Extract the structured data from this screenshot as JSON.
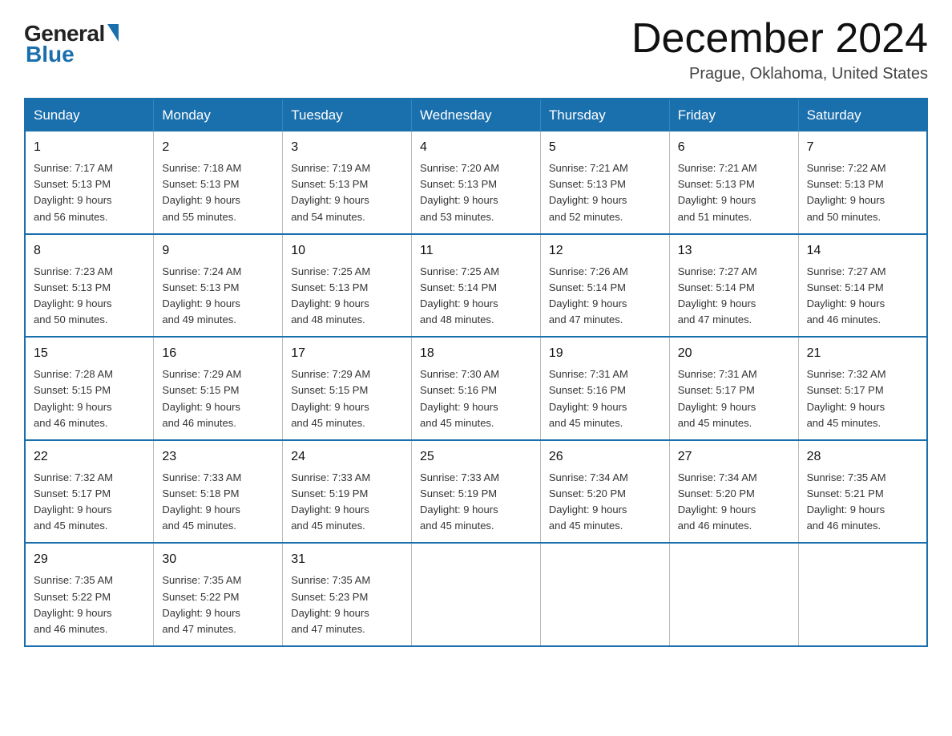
{
  "logo": {
    "general": "General",
    "blue": "Blue"
  },
  "title": "December 2024",
  "subtitle": "Prague, Oklahoma, United States",
  "days_of_week": [
    "Sunday",
    "Monday",
    "Tuesday",
    "Wednesday",
    "Thursday",
    "Friday",
    "Saturday"
  ],
  "weeks": [
    [
      {
        "day": "1",
        "sunrise": "7:17 AM",
        "sunset": "5:13 PM",
        "daylight": "9 hours and 56 minutes."
      },
      {
        "day": "2",
        "sunrise": "7:18 AM",
        "sunset": "5:13 PM",
        "daylight": "9 hours and 55 minutes."
      },
      {
        "day": "3",
        "sunrise": "7:19 AM",
        "sunset": "5:13 PM",
        "daylight": "9 hours and 54 minutes."
      },
      {
        "day": "4",
        "sunrise": "7:20 AM",
        "sunset": "5:13 PM",
        "daylight": "9 hours and 53 minutes."
      },
      {
        "day": "5",
        "sunrise": "7:21 AM",
        "sunset": "5:13 PM",
        "daylight": "9 hours and 52 minutes."
      },
      {
        "day": "6",
        "sunrise": "7:21 AM",
        "sunset": "5:13 PM",
        "daylight": "9 hours and 51 minutes."
      },
      {
        "day": "7",
        "sunrise": "7:22 AM",
        "sunset": "5:13 PM",
        "daylight": "9 hours and 50 minutes."
      }
    ],
    [
      {
        "day": "8",
        "sunrise": "7:23 AM",
        "sunset": "5:13 PM",
        "daylight": "9 hours and 50 minutes."
      },
      {
        "day": "9",
        "sunrise": "7:24 AM",
        "sunset": "5:13 PM",
        "daylight": "9 hours and 49 minutes."
      },
      {
        "day": "10",
        "sunrise": "7:25 AM",
        "sunset": "5:13 PM",
        "daylight": "9 hours and 48 minutes."
      },
      {
        "day": "11",
        "sunrise": "7:25 AM",
        "sunset": "5:14 PM",
        "daylight": "9 hours and 48 minutes."
      },
      {
        "day": "12",
        "sunrise": "7:26 AM",
        "sunset": "5:14 PM",
        "daylight": "9 hours and 47 minutes."
      },
      {
        "day": "13",
        "sunrise": "7:27 AM",
        "sunset": "5:14 PM",
        "daylight": "9 hours and 47 minutes."
      },
      {
        "day": "14",
        "sunrise": "7:27 AM",
        "sunset": "5:14 PM",
        "daylight": "9 hours and 46 minutes."
      }
    ],
    [
      {
        "day": "15",
        "sunrise": "7:28 AM",
        "sunset": "5:15 PM",
        "daylight": "9 hours and 46 minutes."
      },
      {
        "day": "16",
        "sunrise": "7:29 AM",
        "sunset": "5:15 PM",
        "daylight": "9 hours and 46 minutes."
      },
      {
        "day": "17",
        "sunrise": "7:29 AM",
        "sunset": "5:15 PM",
        "daylight": "9 hours and 45 minutes."
      },
      {
        "day": "18",
        "sunrise": "7:30 AM",
        "sunset": "5:16 PM",
        "daylight": "9 hours and 45 minutes."
      },
      {
        "day": "19",
        "sunrise": "7:31 AM",
        "sunset": "5:16 PM",
        "daylight": "9 hours and 45 minutes."
      },
      {
        "day": "20",
        "sunrise": "7:31 AM",
        "sunset": "5:17 PM",
        "daylight": "9 hours and 45 minutes."
      },
      {
        "day": "21",
        "sunrise": "7:32 AM",
        "sunset": "5:17 PM",
        "daylight": "9 hours and 45 minutes."
      }
    ],
    [
      {
        "day": "22",
        "sunrise": "7:32 AM",
        "sunset": "5:17 PM",
        "daylight": "9 hours and 45 minutes."
      },
      {
        "day": "23",
        "sunrise": "7:33 AM",
        "sunset": "5:18 PM",
        "daylight": "9 hours and 45 minutes."
      },
      {
        "day": "24",
        "sunrise": "7:33 AM",
        "sunset": "5:19 PM",
        "daylight": "9 hours and 45 minutes."
      },
      {
        "day": "25",
        "sunrise": "7:33 AM",
        "sunset": "5:19 PM",
        "daylight": "9 hours and 45 minutes."
      },
      {
        "day": "26",
        "sunrise": "7:34 AM",
        "sunset": "5:20 PM",
        "daylight": "9 hours and 45 minutes."
      },
      {
        "day": "27",
        "sunrise": "7:34 AM",
        "sunset": "5:20 PM",
        "daylight": "9 hours and 46 minutes."
      },
      {
        "day": "28",
        "sunrise": "7:35 AM",
        "sunset": "5:21 PM",
        "daylight": "9 hours and 46 minutes."
      }
    ],
    [
      {
        "day": "29",
        "sunrise": "7:35 AM",
        "sunset": "5:22 PM",
        "daylight": "9 hours and 46 minutes."
      },
      {
        "day": "30",
        "sunrise": "7:35 AM",
        "sunset": "5:22 PM",
        "daylight": "9 hours and 47 minutes."
      },
      {
        "day": "31",
        "sunrise": "7:35 AM",
        "sunset": "5:23 PM",
        "daylight": "9 hours and 47 minutes."
      },
      null,
      null,
      null,
      null
    ]
  ],
  "labels": {
    "sunrise": "Sunrise:",
    "sunset": "Sunset:",
    "daylight": "Daylight:"
  }
}
